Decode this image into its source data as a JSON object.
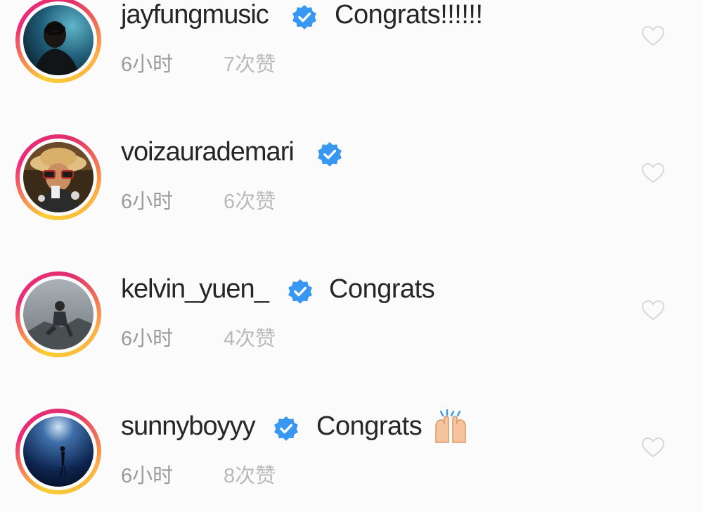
{
  "comments": [
    {
      "username": "jayfungmusic",
      "text": "Congrats!!!!!!",
      "time": "6小时",
      "likes": "7次赞"
    },
    {
      "username": "voizaurademari",
      "text": "",
      "time": "6小时",
      "likes": "6次赞"
    },
    {
      "username": "kelvin_yuen_",
      "text": "Congrats",
      "time": "6小时",
      "likes": "4次赞"
    },
    {
      "username": "sunnyboyyy",
      "text": "Congrats",
      "emoji": "raising-hands-icon",
      "time": "6小时",
      "likes": "8次赞"
    }
  ],
  "colors": {
    "verified_blue": "#3897f0",
    "meta_gray": "#9a9a9a",
    "heart_outline": "#d8d8d8",
    "story_ring_start": "#f9ce34",
    "story_ring_end": "#ee2a7b"
  }
}
